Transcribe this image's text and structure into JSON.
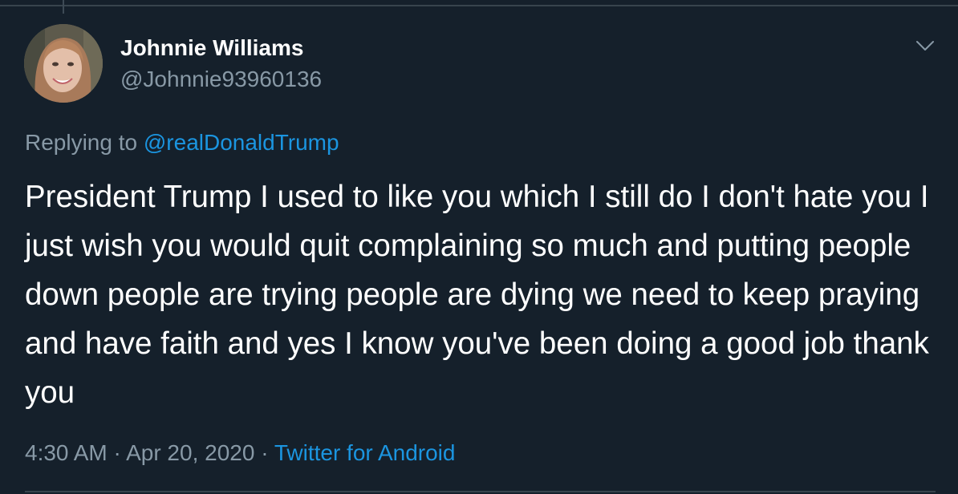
{
  "tweet": {
    "display_name": "Johnnie Williams",
    "handle": "@Johnnie93960136",
    "replying_prefix": "Replying to",
    "replying_to": "@realDonaldTrump",
    "text": "President Trump I used to like you which I still do I don't hate you I just wish you would quit complaining so much and putting people down people are trying people are dying we need to keep praying and have faith and yes I know you've been doing a good job thank you",
    "time": "4:30 AM",
    "separator": "·",
    "date": "Apr 20, 2020",
    "source": "Twitter for Android"
  },
  "icons": {
    "avatar": "user-avatar",
    "menu": "chevron-down-icon"
  },
  "colors": {
    "background": "#15202b",
    "secondary_text": "#8899a6",
    "link": "#1b95e0",
    "border": "#38444d"
  }
}
